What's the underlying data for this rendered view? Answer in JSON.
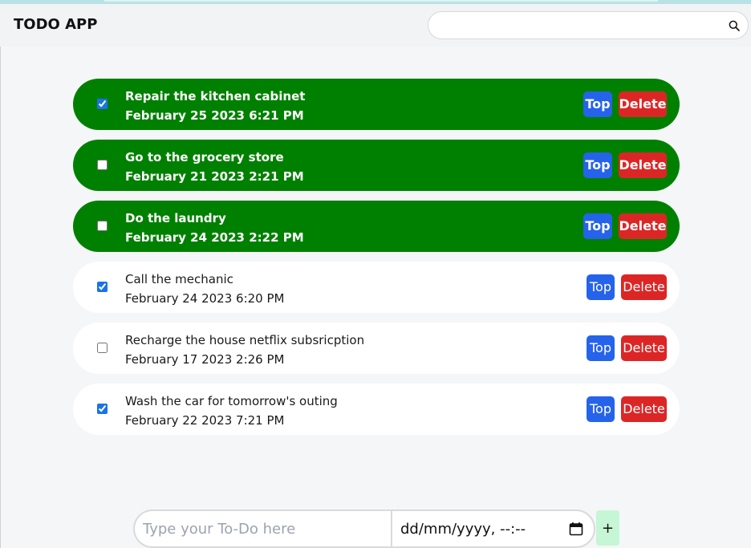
{
  "app": {
    "title": "TODO APP"
  },
  "search": {
    "placeholder": "",
    "value": ""
  },
  "todos": [
    {
      "text": "Repair the kitchen cabinet",
      "date": "February 25 2023 6:21 PM",
      "checked": true,
      "highlighted": true
    },
    {
      "text": "Go to the grocery store",
      "date": "February 21 2023 2:21 PM",
      "checked": false,
      "highlighted": true
    },
    {
      "text": "Do the laundry",
      "date": "February 24 2023 2:22 PM",
      "checked": false,
      "highlighted": true
    },
    {
      "text": "Call the mechanic",
      "date": "February 24 2023 6:20 PM",
      "checked": true,
      "highlighted": false
    },
    {
      "text": "Recharge the house netflix subsricption",
      "date": "February 17 2023 2:26 PM",
      "checked": false,
      "highlighted": false
    },
    {
      "text": "Wash the car for tomorrow's outing",
      "date": "February 22 2023 7:21 PM",
      "checked": true,
      "highlighted": false
    }
  ],
  "buttons": {
    "top_label": "Top",
    "delete_label": "Delete"
  },
  "add_form": {
    "todo_placeholder": "Type your To-Do here",
    "date_placeholder": "dd/mm/yyyy, --:--",
    "add_label": "+"
  },
  "colors": {
    "highlight": "#008000",
    "top_button": "#2563eb",
    "delete_button": "#dc2626",
    "add_button": "#c6f6d5"
  },
  "icons": {
    "search": "search-icon",
    "calendar": "calendar-icon"
  }
}
